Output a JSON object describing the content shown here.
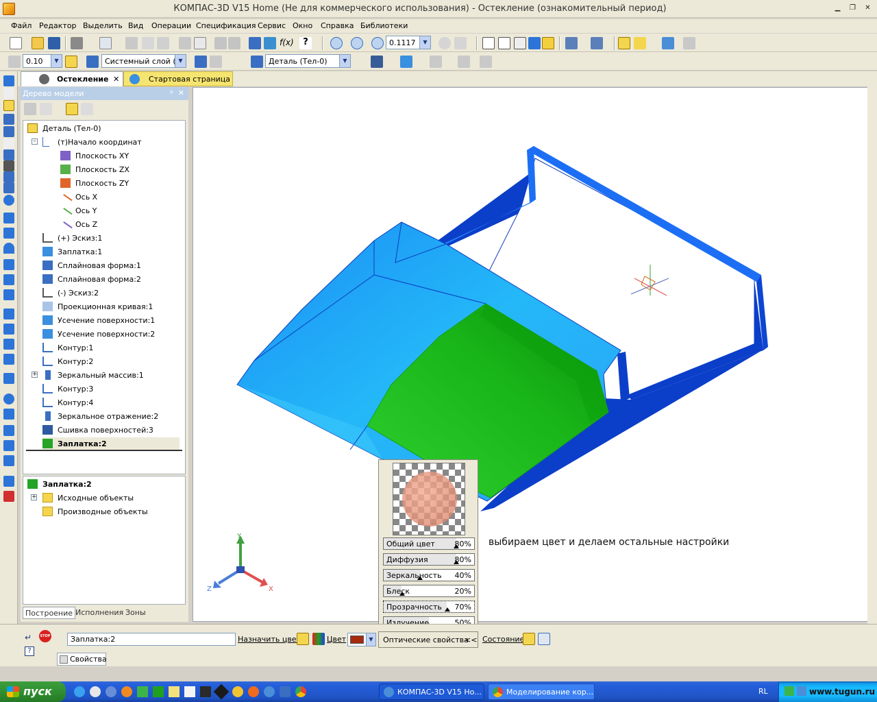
{
  "window": {
    "title": "КОМПАС-3D V15 Home (Не для коммерческого использования) - Остекление (ознакомительный период)"
  },
  "menu": [
    "Файл",
    "Редактор",
    "Выделить",
    "Вид",
    "Операции",
    "Спецификация",
    "Сервис",
    "Окно",
    "Справка",
    "Библиотеки"
  ],
  "toolbar1": {
    "scale": "0.1117",
    "fx_label": "f(x)"
  },
  "toolbar2": {
    "step": "0.10",
    "layer": "Системный слой (0)",
    "part": "Деталь (Тел-0)"
  },
  "tabs": [
    {
      "label": "Остекление",
      "close": "✕"
    },
    {
      "label": "Стартовая страница"
    }
  ],
  "tree": {
    "header": "Дерево модели",
    "pin": "ᵖ",
    "close": "✕",
    "nodes": [
      {
        "label": "Деталь (Тел-0)"
      },
      {
        "label": "(т)Начало координат"
      },
      {
        "label": "Плоскость XY"
      },
      {
        "label": "Плоскость ZX"
      },
      {
        "label": "Плоскость ZY"
      },
      {
        "label": "Ось X"
      },
      {
        "label": "Ось Y"
      },
      {
        "label": "Ось Z"
      },
      {
        "label": "(+) Эскиз:1"
      },
      {
        "label": "Заплатка:1"
      },
      {
        "label": "Сплайновая форма:1"
      },
      {
        "label": "Сплайновая форма:2"
      },
      {
        "label": "(-) Эскиз:2"
      },
      {
        "label": "Проекционная кривая:1"
      },
      {
        "label": "Усечение поверхности:1"
      },
      {
        "label": "Усечение поверхности:2"
      },
      {
        "label": "Контур:1"
      },
      {
        "label": "Контур:2"
      },
      {
        "label": "Зеркальный массив:1"
      },
      {
        "label": "Контур:3"
      },
      {
        "label": "Контур:4"
      },
      {
        "label": "Зеркальное отражение:2"
      },
      {
        "label": "Сшивка поверхностей:3"
      },
      {
        "label": "Заплатка:2"
      }
    ],
    "detail_title": "Заплатка:2",
    "detail_items": [
      "Исходные объекты",
      "Производные объекты"
    ],
    "bottom_tabs": [
      "Построение",
      "Исполнения",
      "Зоны"
    ]
  },
  "viewport": {
    "caption": "выбираем цвет и делаем остальные настройки",
    "axes": {
      "x": "X",
      "y": "Y",
      "z": "Z"
    }
  },
  "optical": {
    "sliders": [
      {
        "label": "Общий цвет",
        "value": "80%",
        "level": 0.8
      },
      {
        "label": "Диффузия",
        "value": "80%",
        "level": 0.8
      },
      {
        "label": "Зеркальность",
        "value": "40%",
        "level": 0.4
      },
      {
        "label": "Блеск",
        "value": "20%",
        "level": 0.2
      },
      {
        "label": "Прозрачность",
        "value": "70%",
        "level": 0.7
      },
      {
        "label": "Излучение",
        "value": "50%",
        "level": 0.5
      }
    ]
  },
  "props": {
    "object_name": "Заплатка:2",
    "assign_color": "Назначить цвет",
    "color_label": "Цвет",
    "color_value": "#a52a0e",
    "optical_button": "Оптические свойства",
    "optical_chev": "<<",
    "state_label": "Состояние",
    "tab": "Свойства",
    "stop": "STOP"
  },
  "taskbar": {
    "start": "пуск",
    "tasks": [
      "КОМПАС-3D V15 Но...",
      "Моделирование кор..."
    ],
    "lang": "RL",
    "site": "www.tugun.ru"
  }
}
